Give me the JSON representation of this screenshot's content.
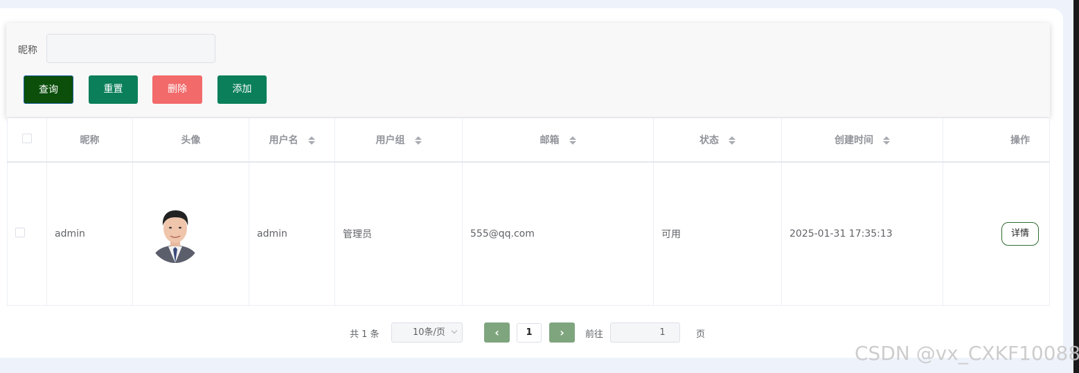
{
  "search": {
    "label": "昵称",
    "placeholder": "",
    "value": ""
  },
  "buttons": {
    "query": "查询",
    "reset": "重置",
    "delete": "删除",
    "add": "添加"
  },
  "table": {
    "headers": {
      "nickname": "昵称",
      "avatar": "头像",
      "username": "用户名",
      "group": "用户组",
      "email": "邮箱",
      "status": "状态",
      "created": "创建时间",
      "operation": "操作"
    },
    "rows": [
      {
        "nickname": "admin",
        "username": "admin",
        "group": "管理员",
        "email": "555@qq.com",
        "status": "可用",
        "created": "2025-01-31 17:35:13",
        "detail_label": "详情"
      }
    ]
  },
  "pagination": {
    "total": "共 1 条",
    "page_size": "10条/页",
    "current_page": "1",
    "goto_label": "前往",
    "goto_value": "1",
    "page_suffix": "页",
    "prev_icon": "‹",
    "next_icon": "›"
  },
  "watermark": "CSDN @vx_CXKF10088",
  "colors": {
    "query": "#0b4f0b",
    "reset": "#0a7f5a",
    "delete": "#f26a6a",
    "add": "#0a7f5a",
    "pager": "#7fa57f"
  }
}
